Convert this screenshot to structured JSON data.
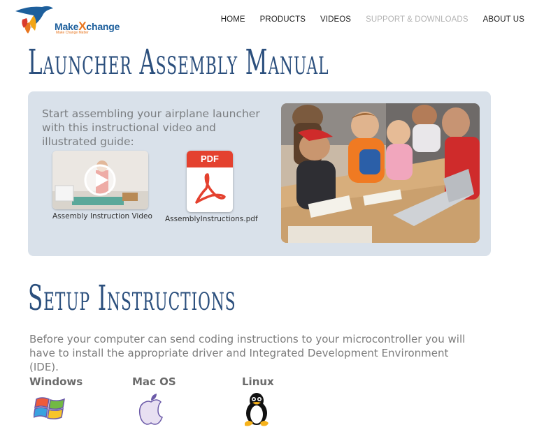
{
  "header": {
    "logo_text_a": "Make",
    "logo_text_x": "X",
    "logo_text_b": "change",
    "logo_tagline": "Make Change Matter",
    "nav": [
      "HOME",
      "PRODUCTS",
      "VIDEOS",
      "SUPPORT & DOWNLOADS",
      "ABOUT US"
    ],
    "active_nav": "SUPPORT & DOWNLOADS"
  },
  "manual": {
    "title": "Launcher Assembly Manual",
    "intro": "Start assembling your airplane launcher with this instructional video and illustrated guide:",
    "video_caption": "Assembly Instruction Video",
    "pdf_label": "PDF",
    "pdf_caption": "AssemblyInstructions.pdf"
  },
  "setup": {
    "title": "Setup Instructions",
    "text": "Before your computer can send coding instructions to your microcontroller you will have to install the appropriate driver and Integrated Development Environment (IDE).",
    "os": [
      {
        "label": "Windows",
        "icon": "windows-icon"
      },
      {
        "label": "Mac OS",
        "icon": "apple-icon"
      },
      {
        "label": "Linux",
        "icon": "tux-icon"
      }
    ]
  },
  "colors": {
    "title": "#2b4f7d",
    "panel": "#d9e1ea",
    "pdf_red": "#e4412f",
    "logo_blue": "#1d5f9c",
    "logo_orange": "#e8751e"
  }
}
